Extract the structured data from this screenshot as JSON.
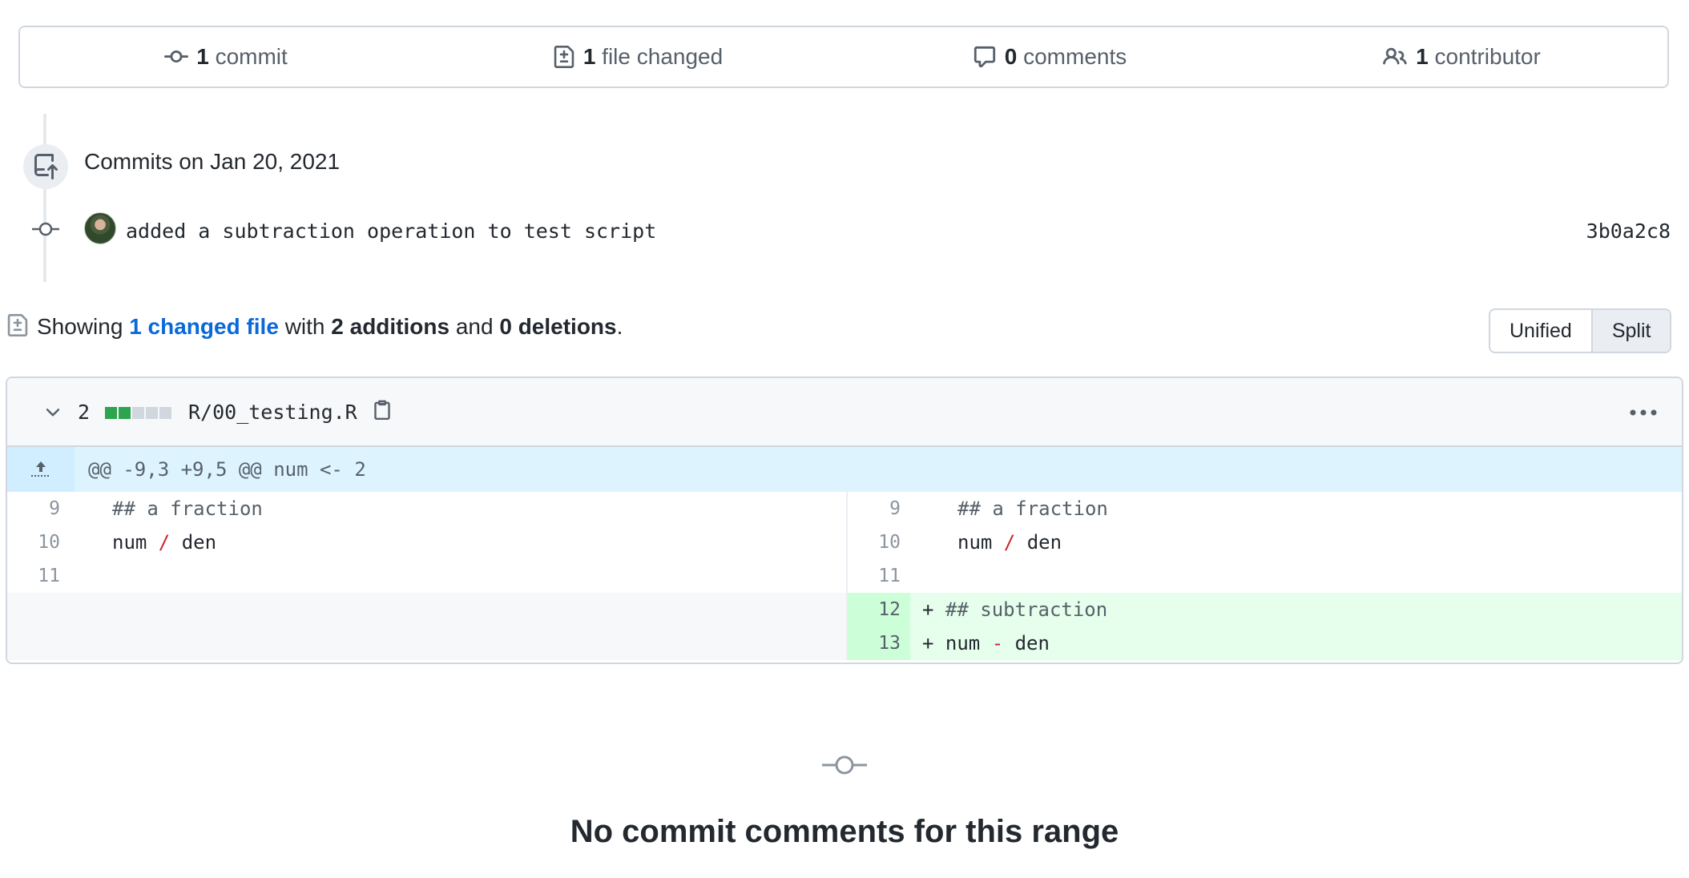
{
  "summary": {
    "commits": {
      "count": "1",
      "label": "commit"
    },
    "files": {
      "count": "1",
      "label": "file changed"
    },
    "comments": {
      "count": "0",
      "label": "comments"
    },
    "contributors": {
      "count": "1",
      "label": "contributor"
    }
  },
  "timeline": {
    "heading": "Commits on Jan 20, 2021",
    "commit": {
      "message": "added a subtraction operation to test script",
      "sha": "3b0a2c8"
    }
  },
  "showing": {
    "prefix": "Showing",
    "changed_link": "1 changed file",
    "with": "with",
    "additions": "2 additions",
    "and": "and",
    "deletions": "0 deletions",
    "period": "."
  },
  "view_toggle": {
    "unified": "Unified",
    "split": "Split"
  },
  "file": {
    "change_count": "2",
    "path": "R/00_testing.R",
    "diffstat": [
      "added",
      "added",
      "neutral",
      "neutral",
      "neutral"
    ],
    "hunk_header": "@@ -9,3 +9,5 @@ num <- 2",
    "left_lines": [
      {
        "num": "9",
        "code": "## a fraction"
      },
      {
        "num": "10",
        "code_a": "num ",
        "op": "/",
        "code_b": " den"
      },
      {
        "num": "11",
        "code": ""
      }
    ],
    "right_lines": [
      {
        "num": "9",
        "code": "## a fraction"
      },
      {
        "num": "10",
        "code_a": "num ",
        "op": "/",
        "code_b": " den"
      },
      {
        "num": "11",
        "code": ""
      },
      {
        "num": "12",
        "marker": "+",
        "code": "## subtraction"
      },
      {
        "num": "13",
        "marker": "+",
        "code_a": "num ",
        "op": "-",
        "code_b": " den"
      }
    ]
  },
  "empty_state": {
    "title": "No commit comments for this range"
  },
  "colors": {
    "link": "#0969da",
    "addition_bg": "#e6ffec",
    "addition_num_bg": "#ccffd8",
    "hunk_bg": "#ddf4ff",
    "operator": "#cf222e",
    "diffstat_added": "#2da44e",
    "diffstat_neutral": "#d0d7de"
  }
}
